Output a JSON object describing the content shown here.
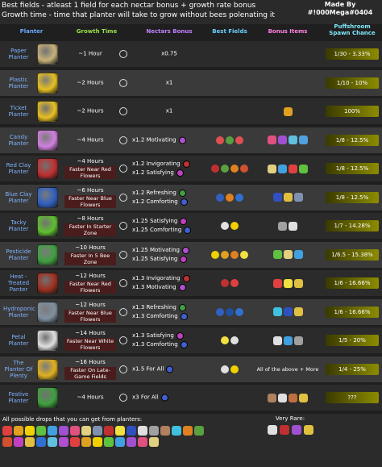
{
  "header": {
    "line1": "Best fields - atleast 1 field for each nectar bonus + growth rate bonus",
    "line2": "Growth time - time that planter will take to grow without bees polenating it",
    "made_by_label": "Made By",
    "made_by_name": "#!000Mega#0404"
  },
  "columns": {
    "planter": "Planter",
    "growth": "Growth Time",
    "nectars": "Nectars Bonus",
    "fields": "Best Fields",
    "items": "Bonus Items",
    "spawn": "Puffshroom Spawn Chance"
  },
  "rows": [
    {
      "name": "Paper Planter",
      "color": "#c8b27a",
      "growth": "~1 Hour",
      "note": "",
      "bonus": [
        {
          "text": "x0.75",
          "icon": ""
        }
      ],
      "fields": [],
      "items": [],
      "items_text": "",
      "spawn": "1/30 - 3.33%"
    },
    {
      "name": "Plastic Planter",
      "color": "#e8c020",
      "growth": "~2 Hours",
      "note": "",
      "bonus": [
        {
          "text": "x1",
          "icon": ""
        }
      ],
      "fields": [],
      "items": [],
      "items_text": "",
      "spawn": "1/10 - 10%"
    },
    {
      "name": "Ticket Planter",
      "color": "#e8c020",
      "growth": "~2 Hours",
      "note": "",
      "bonus": [
        {
          "text": "x1",
          "icon": ""
        }
      ],
      "fields": [],
      "items": [
        "#e0a020"
      ],
      "items_text": "",
      "spawn": "100%"
    },
    {
      "name": "Candy Planter",
      "color": "#d080e0",
      "growth": "~4 Hours",
      "note": "",
      "bonus": [
        {
          "text": "x1.2 Motivating",
          "icon": "#b050d0"
        }
      ],
      "fields": [
        "#e05050",
        "#5aa040",
        "#e05050"
      ],
      "items": [
        "#e05080",
        "#a050d0",
        "#60c0e0",
        "#50a0e0"
      ],
      "items_text": "",
      "spawn": "1/8 - 12.5%"
    },
    {
      "name": "Red Clay Planter",
      "color": "#c03030",
      "growth": "~4 Hours",
      "note": "Faster Near Red Flowers",
      "bonus": [
        {
          "text": "x1.2 Invigorating",
          "icon": "#c03030"
        },
        {
          "text": "x1.2 Satisfying",
          "icon": "#c040c0"
        }
      ],
      "fields": [
        "#c03030",
        "#5aa040",
        "#e08020",
        "#d05030"
      ],
      "items": [
        "#e0d080",
        "#40a0e0",
        "#e04040",
        "#60c040"
      ],
      "items_text": "",
      "spawn": "1/8 - 12.5%"
    },
    {
      "name": "Blue Clay Planter",
      "color": "#3060c0",
      "growth": "~6 Hours",
      "note": "Faster Near Blue Flowers",
      "bonus": [
        {
          "text": "x1.2 Refreshing",
          "icon": "#40a040"
        },
        {
          "text": "x1.2 Comforting",
          "icon": "#4060d0"
        }
      ],
      "fields": [
        "#3060c0",
        "#e08020",
        "#3070d0"
      ],
      "items": [
        "#3050c0",
        "#e0c040",
        "#8090b0"
      ],
      "items_text": "",
      "spawn": "1/8 - 12.5%"
    },
    {
      "name": "Tacky Planter",
      "color": "#60c030",
      "growth": "~8 Hours",
      "note": "Faster In Starter Zone",
      "bonus": [
        {
          "text": "x1.25 Satisfying",
          "icon": "#c040c0"
        },
        {
          "text": "x1.25 Comforting",
          "icon": "#4060d0"
        }
      ],
      "fields": [
        "#e0e0e0",
        "#f0d000"
      ],
      "items": [
        "#a0a0a0",
        "#e0e0e0"
      ],
      "items_text": "",
      "spawn": "1/7 - 14.28%"
    },
    {
      "name": "Pesticide Planter",
      "color": "#40a040",
      "growth": "~10 Hours",
      "note": "Faster In 5 Bee Zone",
      "bonus": [
        {
          "text": "x1.25 Motivating",
          "icon": "#b050d0"
        },
        {
          "text": "x1.25 Satisfying",
          "icon": "#c040c0"
        }
      ],
      "fields": [
        "#f0d000",
        "#e0a020",
        "#e08020",
        "#f0e040"
      ],
      "items": [
        "#60c040",
        "#e0d080",
        "#40a0e0"
      ],
      "items_text": "",
      "spawn": "1/6.5 - 15.38%"
    },
    {
      "name": "Heat -Treated Panter",
      "color": "#a03020",
      "growth": "~12 Hours",
      "note": "Faster Near Red Flowers",
      "bonus": [
        {
          "text": "x1.3 Invigorating",
          "icon": "#c03030"
        },
        {
          "text": "x1.3 Motivating",
          "icon": "#b050d0"
        }
      ],
      "fields": [
        "#c03030",
        "#e04040"
      ],
      "items": [
        "#e04040",
        "#f0e040",
        "#e0c040"
      ],
      "items_text": "",
      "spawn": "1/6 - 16.66%"
    },
    {
      "name": "Hydroponic Planter",
      "color": "#8090a0",
      "growth": "~12 Hours",
      "note": "Faster Near Blue Flowers",
      "bonus": [
        {
          "text": "x1.3 Refreshing",
          "icon": "#40a040"
        },
        {
          "text": "x1.3 Comforting",
          "icon": "#4060d0"
        }
      ],
      "fields": [
        "#3060c0",
        "#2050a0",
        "#3070d0"
      ],
      "items": [
        "#40c0e0",
        "#3050c0",
        "#e0c040"
      ],
      "items_text": "",
      "spawn": "1/6 - 16.66%"
    },
    {
      "name": "Petal Planter",
      "color": "#e0e0e0",
      "growth": "~14 Hours",
      "note": "Faster Near White Flowers",
      "bonus": [
        {
          "text": "x1.3 Satisfying",
          "icon": "#c040c0"
        },
        {
          "text": "x1.3 Comforting",
          "icon": "#4060d0"
        }
      ],
      "fields": [
        "#f0e040",
        "#e0e0e0"
      ],
      "items": [
        "#e0e0e0",
        "#40a0e0",
        "#a0a0a0"
      ],
      "items_text": "",
      "spawn": "1/5 - 20%"
    },
    {
      "name": "The Planter Of Plenty",
      "color": "#e0b020",
      "growth": "~16 Hours",
      "note": "Faster On Late-Game Fields",
      "bonus": [
        {
          "text": "x1.5 For All",
          "icon": "#4060d0"
        }
      ],
      "fields": [
        "#e0e0e0",
        "#f0d000"
      ],
      "items": [],
      "items_text": "All of the above + More",
      "spawn": "1/4 - 25%"
    },
    {
      "name": "Festive Planter",
      "color": "#40a040",
      "growth": "~4 Hours",
      "note": "",
      "bonus": [
        {
          "text": "x3 For All",
          "icon": "#4060d0"
        }
      ],
      "fields": [],
      "items": [
        "#b08060",
        "#e0e0e0",
        "#c07040",
        "#e0c040"
      ],
      "items_text": "",
      "spawn": "???"
    }
  ],
  "footer": {
    "title": "All possible drops that you can get from planters:",
    "rare_title": "Very Rare:",
    "drops": [
      "#e04040",
      "#e0a020",
      "#f0d000",
      "#60c040",
      "#40a0e0",
      "#a050d0",
      "#e05080",
      "#e0d080",
      "#8090b0",
      "#c03030",
      "#f0e040",
      "#3050c0",
      "#e0e0e0",
      "#a0a0a0",
      "#b08060",
      "#40c0e0",
      "#e08020",
      "#5aa040",
      "#d05030",
      "#c040c0",
      "#e0c040",
      "#3070d0",
      "#60c0e0",
      "#b050d0",
      "#e04040",
      "#e0a020",
      "#f0d000",
      "#60c040",
      "#40a0e0",
      "#a050d0",
      "#e05080",
      "#e0d080"
    ],
    "rare": [
      "#e0e0e0",
      "#c03030",
      "#a050d0",
      "#e0c040"
    ]
  }
}
